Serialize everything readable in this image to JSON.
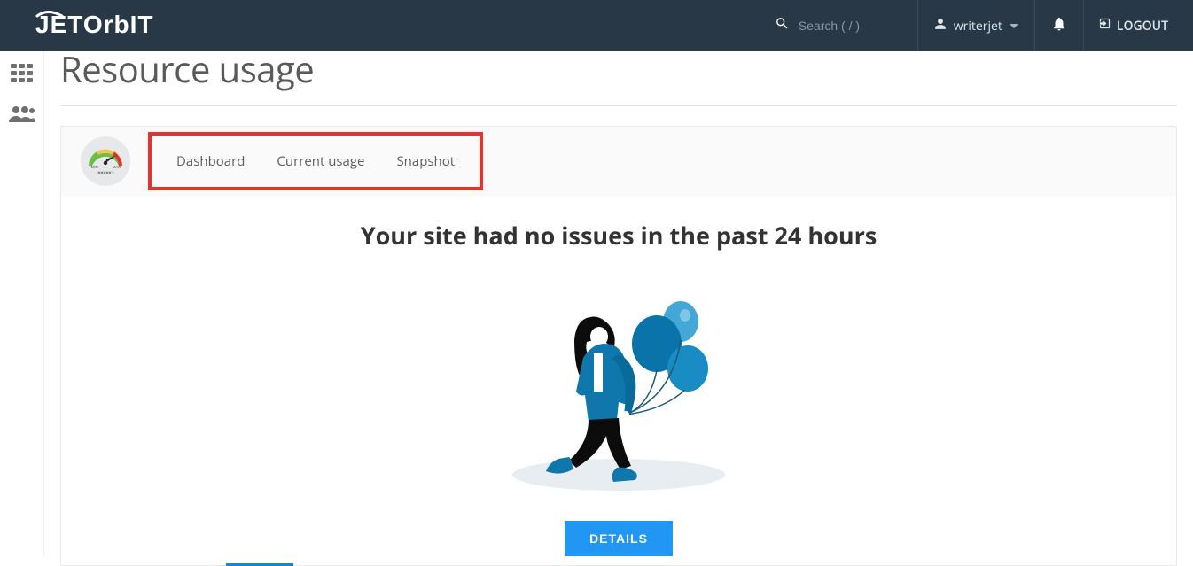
{
  "brand": {
    "name": "Jetorbit"
  },
  "header": {
    "search_placeholder": "Search ( / )",
    "username": "writerjet",
    "logout_label": "LOGOUT"
  },
  "page": {
    "title": "Resource usage",
    "tabs": [
      {
        "label": "Dashboard",
        "active": true
      },
      {
        "label": "Current usage",
        "active": false
      },
      {
        "label": "Snapshot",
        "active": false
      }
    ],
    "status_heading": "Your site had no issues in the past 24 hours",
    "details_button": "DETAILS"
  }
}
